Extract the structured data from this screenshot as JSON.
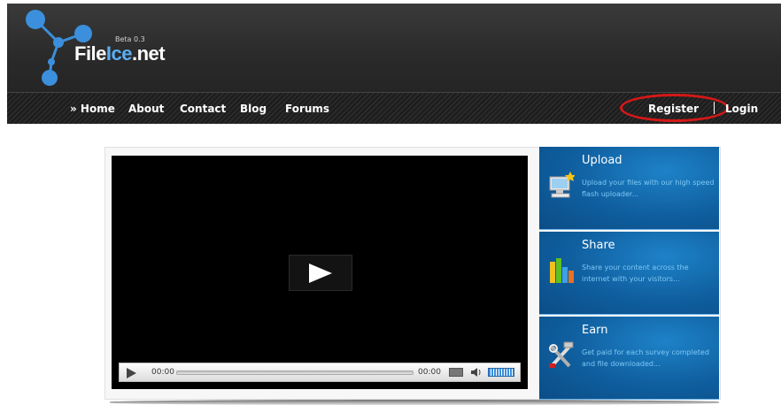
{
  "site": {
    "name_part1": "File",
    "name_part2": "Ice",
    "name_part3": ".net",
    "beta": "Beta 0.3"
  },
  "nav": {
    "home": "» Home",
    "about": "About",
    "contact": "Contact",
    "blog": "Blog",
    "forums": "Forums",
    "register": "Register",
    "login": "Login"
  },
  "video": {
    "time_current": "00:00",
    "time_total": "00:00"
  },
  "panels": [
    {
      "title": "Upload",
      "desc": "Upload your files with our high speed flash uploader...",
      "icon": "computer-upload-icon"
    },
    {
      "title": "Share",
      "desc": "Share your content across the internet with your visitors...",
      "icon": "bar-chart-icon"
    },
    {
      "title": "Earn",
      "desc": "Get paid for each survey completed and file downloaded...",
      "icon": "tools-icon"
    }
  ],
  "colors": {
    "accent_blue": "#5aaef5",
    "panel_blue": "#0f5e9e",
    "highlight_red": "#d41818"
  }
}
